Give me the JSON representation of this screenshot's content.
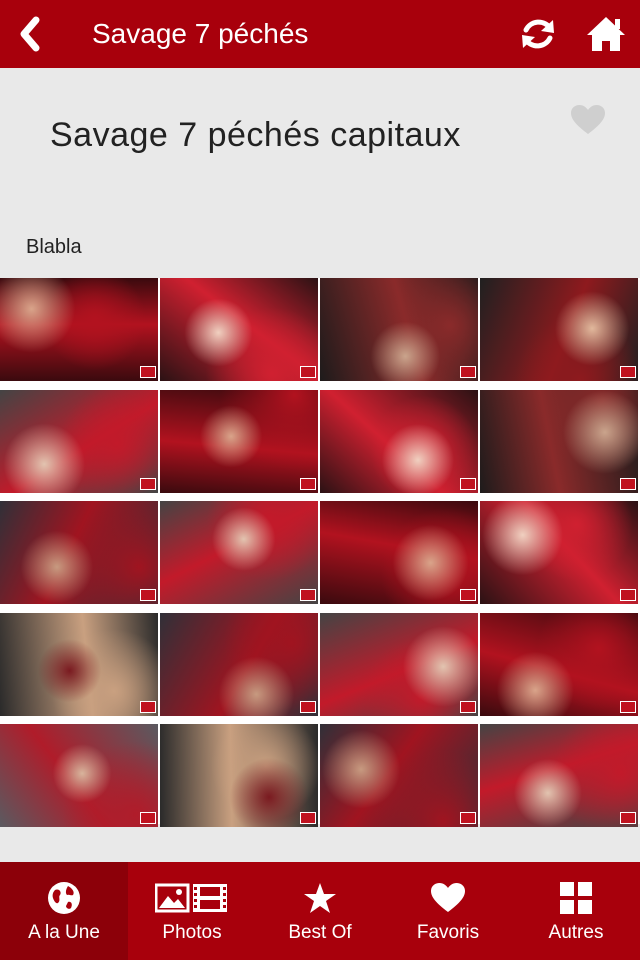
{
  "topbar": {
    "title": "Savage 7 péchés",
    "back_icon": "chevron-left-icon",
    "refresh_icon": "refresh-icon",
    "home_icon": "home-icon"
  },
  "article": {
    "headline": "Savage 7 péchés capitaux",
    "description": "Blabla",
    "favorite_icon": "heart-icon"
  },
  "gallery": {
    "rows": 5,
    "columns": 4,
    "photo_count": 20
  },
  "bottom_nav": {
    "items": [
      {
        "label": "A la Une",
        "icon": "globe-icon",
        "active": true
      },
      {
        "label": "Photos",
        "icon": "photos-icon",
        "active": false
      },
      {
        "label": "Best Of",
        "icon": "star-icon",
        "active": false
      },
      {
        "label": "Favoris",
        "icon": "heart-icon",
        "active": false
      },
      {
        "label": "Autres",
        "icon": "grid-icon",
        "active": false
      }
    ]
  },
  "colors": {
    "brand": "#a8000c",
    "brand_dark": "#8c0009",
    "background": "#e9e9e9",
    "heart_inactive": "#cfcfcf"
  }
}
